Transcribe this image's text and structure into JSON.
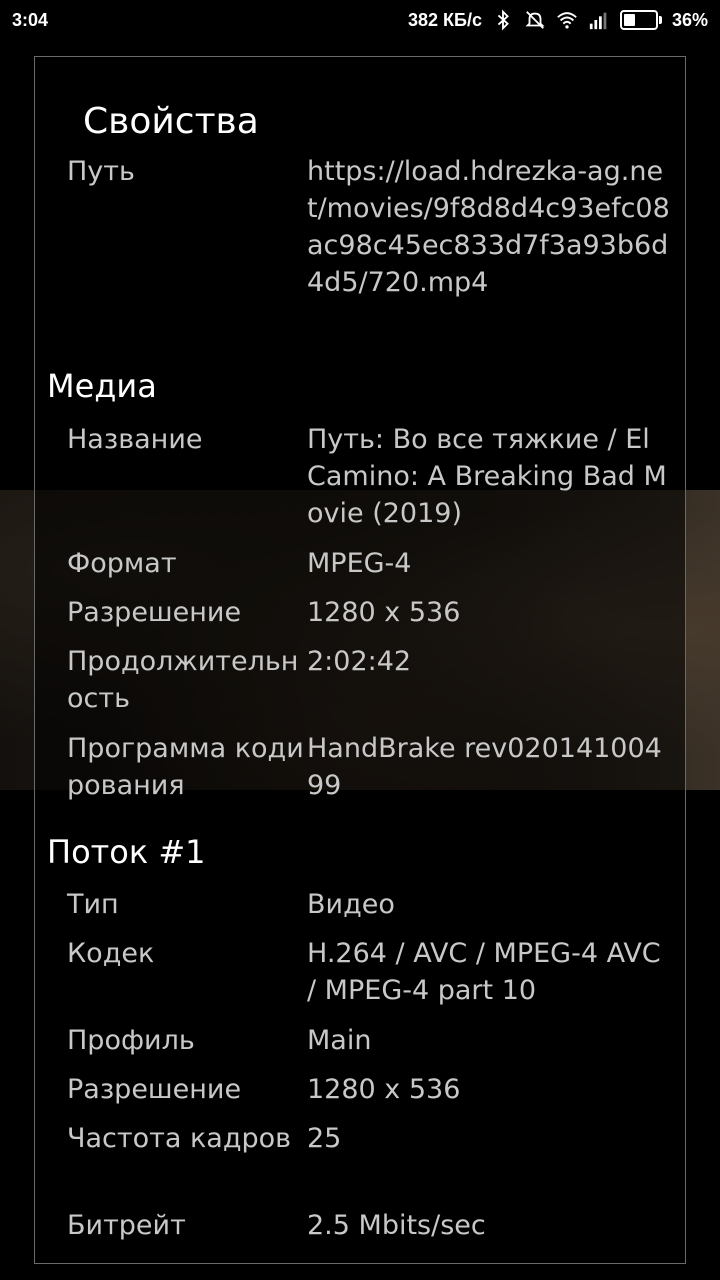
{
  "status_bar": {
    "time": "3:04",
    "net_speed": "382 КБ/с",
    "battery_percent": "36%",
    "battery_level": 0.36,
    "icons": [
      "bluetooth-icon",
      "mute-icon",
      "wifi-icon",
      "signal-icon",
      "battery-icon"
    ]
  },
  "dialog": {
    "title": "Свойства",
    "path_label": "Путь",
    "path_value": "https://load.hdrezka-ag.net/movies/9f8d8d4c93efc08ac98c45ec833d7f3a93b6d4d5/720.mp4",
    "media": {
      "title": "Медиа",
      "rows": [
        {
          "label": "Название",
          "value": "Путь: Во все тяжкие / El Camino: A Breaking Bad Movie (2019)"
        },
        {
          "label": "Формат",
          "value": "MPEG-4"
        },
        {
          "label": "Разрешение",
          "value": "1280 x 536"
        },
        {
          "label": "Продолжительность",
          "value": "2:02:42"
        },
        {
          "label": "Программа кодирования",
          "value": "HandBrake rev02014100499"
        }
      ]
    },
    "stream": {
      "title": "Поток #1",
      "rows": [
        {
          "label": "Тип",
          "value": "Видео"
        },
        {
          "label": "Кодек",
          "value": "H.264 / AVC / MPEG-4 AVC / MPEG-4 part 10"
        },
        {
          "label": "Профиль",
          "value": "Main"
        },
        {
          "label": "Разрешение",
          "value": "1280 x 536"
        },
        {
          "label": "Частота кадров",
          "value": "25"
        },
        {
          "label": "Битрейт",
          "value": "2.5 Mbits/sec"
        }
      ]
    }
  }
}
